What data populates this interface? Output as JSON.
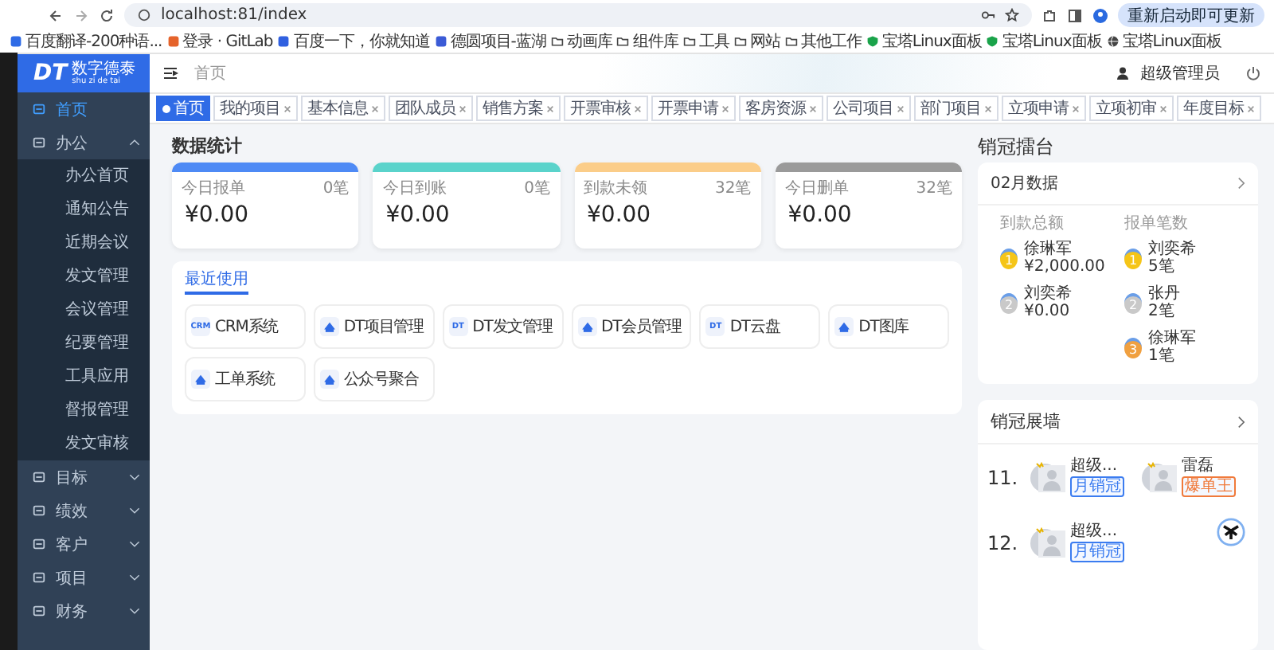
{
  "browser": {
    "url": "localhost:81/index",
    "update_button": "重新启动即可更新",
    "bookmarks": [
      {
        "label": "百度翻译-200种语...",
        "kind": "site"
      },
      {
        "label": "登录 · GitLab",
        "kind": "site"
      },
      {
        "label": "百度一下，你就知道",
        "kind": "site"
      },
      {
        "label": "德圆项目-蓝湖",
        "kind": "site"
      },
      {
        "label": "动画库",
        "kind": "folder"
      },
      {
        "label": "组件库",
        "kind": "folder"
      },
      {
        "label": "工具",
        "kind": "folder"
      },
      {
        "label": "网站",
        "kind": "folder"
      },
      {
        "label": "其他工作",
        "kind": "folder"
      },
      {
        "label": "宝塔Linux面板",
        "kind": "shield"
      },
      {
        "label": "宝塔Linux面板",
        "kind": "shield"
      },
      {
        "label": "宝塔Linux面板",
        "kind": "globe"
      }
    ]
  },
  "sidebar": {
    "logo": "DT",
    "brand": "数字德泰",
    "brand_pinyin": "shu zi de tai",
    "items": [
      {
        "label": "首页",
        "selected": true
      },
      {
        "label": "办公",
        "selected": false,
        "expanded": true,
        "children": [
          {
            "label": "办公首页",
            "selected": false
          },
          {
            "label": "通知公告",
            "selected": false
          },
          {
            "label": "近期会议",
            "selected": false
          },
          {
            "label": "发文管理",
            "selected": false
          },
          {
            "label": "会议管理",
            "selected": false
          },
          {
            "label": "纪要管理",
            "selected": false
          },
          {
            "label": "工具应用",
            "selected": false
          },
          {
            "label": "督报管理",
            "selected": false
          },
          {
            "label": "发文审核",
            "selected": false
          }
        ]
      },
      {
        "label": "目标",
        "selected": false,
        "expanded": false
      },
      {
        "label": "绩效",
        "selected": false,
        "expanded": false
      },
      {
        "label": "客户",
        "selected": false,
        "expanded": false
      },
      {
        "label": "项目",
        "selected": false,
        "expanded": false
      },
      {
        "label": "财务",
        "selected": false,
        "expanded": false
      }
    ]
  },
  "header": {
    "breadcrumb": "首页",
    "user": "超级管理员"
  },
  "tabs": [
    {
      "label": "首页",
      "selected": true
    },
    {
      "label": "我的项目",
      "selected": false
    },
    {
      "label": "基本信息",
      "selected": false
    },
    {
      "label": "团队成员",
      "selected": false
    },
    {
      "label": "销售方案",
      "selected": false
    },
    {
      "label": "开票审核",
      "selected": false
    },
    {
      "label": "开票申请",
      "selected": false
    },
    {
      "label": "客房资源",
      "selected": false
    },
    {
      "label": "公司项目",
      "selected": false
    },
    {
      "label": "部门项目",
      "selected": false
    },
    {
      "label": "立项申请",
      "selected": false
    },
    {
      "label": "立项初审",
      "selected": false
    },
    {
      "label": "年度目标",
      "selected": false
    }
  ],
  "stats": {
    "title": "数据统计",
    "cards": [
      {
        "label": "今日报单",
        "count": "0笔",
        "amount": "¥0.00",
        "color": "#4e8af5"
      },
      {
        "label": "今日到账",
        "count": "0笔",
        "amount": "¥0.00",
        "color": "#5ad3cb"
      },
      {
        "label": "到款未领",
        "count": "32笔",
        "amount": "¥0.00",
        "color": "#fbcd89"
      },
      {
        "label": "今日删单",
        "count": "32笔",
        "amount": "¥0.00",
        "color": "#9a9a9a"
      }
    ]
  },
  "recent": {
    "tab": "最近使用",
    "apps": [
      {
        "label": "CRM系统",
        "icon_text": "CRM"
      },
      {
        "label": "DT项目管理"
      },
      {
        "label": "DT发文管理",
        "icon_text": "DT"
      },
      {
        "label": "DT会员管理"
      },
      {
        "label": "DT云盘",
        "icon_text": "DT"
      },
      {
        "label": "DT图库"
      },
      {
        "label": "工单系统"
      },
      {
        "label": "公众号聚合"
      }
    ]
  },
  "leaderboard": {
    "title": "销冠擂台",
    "period": "02月数据",
    "columns": [
      {
        "heading": "到款总额",
        "entries": [
          {
            "rank": "1",
            "name": "徐琳军",
            "value": "¥2,000.00"
          },
          {
            "rank": "2",
            "name": "刘奕希",
            "value": "¥0.00"
          }
        ]
      },
      {
        "heading": "报单笔数",
        "entries": [
          {
            "rank": "1",
            "name": "刘奕希",
            "value": "5笔"
          },
          {
            "rank": "2",
            "name": "张丹",
            "value": "2笔"
          },
          {
            "rank": "3",
            "name": "徐琳军",
            "value": "1笔"
          }
        ]
      }
    ]
  },
  "wall": {
    "title": "销冠展墙",
    "rows": [
      {
        "index": "11.",
        "people": [
          {
            "name": "超级...",
            "badge": "月销冠",
            "color": "#3b7cf0"
          },
          {
            "name": "雷磊",
            "badge": "爆单王",
            "color": "#f07a3b"
          }
        ]
      },
      {
        "index": "12.",
        "people": [
          {
            "name": "超级...",
            "badge": "月销冠",
            "color": "#3b7cf0"
          }
        ]
      }
    ]
  }
}
